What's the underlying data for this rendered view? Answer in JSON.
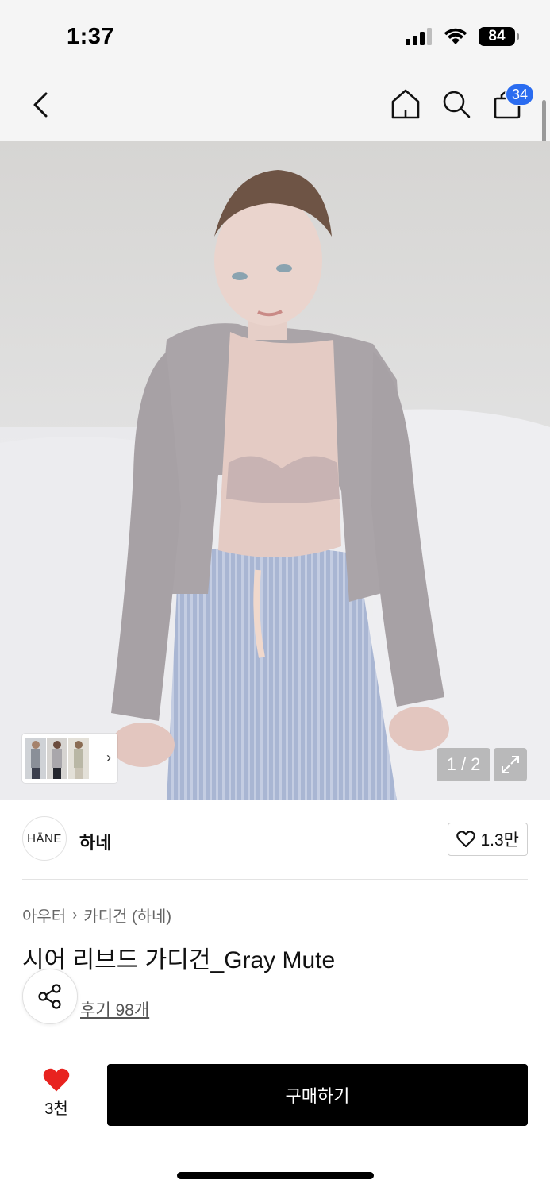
{
  "status_bar": {
    "time": "1:37",
    "battery": "84"
  },
  "nav": {
    "back_icon": "chevron-left-icon",
    "home_icon": "home-icon",
    "search_icon": "search-icon",
    "cart_icon": "shopping-bag-icon",
    "cart_count": "34",
    "badge_color": "#2a6cf0"
  },
  "gallery": {
    "pager": "1 / 2",
    "expand_icon": "expand-icon"
  },
  "brand": {
    "logo_text": "HÄNE",
    "name": "하네",
    "likes": "1.3만"
  },
  "product": {
    "breadcrumb": [
      "아우터",
      "카디건 (하네)"
    ],
    "title": "시어 리브드 가디건_Gray Mute",
    "reviews": "후기 98개"
  },
  "actions": {
    "wish_count": "3천",
    "buy_label": "구매하기",
    "wish_color": "#e8231f"
  }
}
